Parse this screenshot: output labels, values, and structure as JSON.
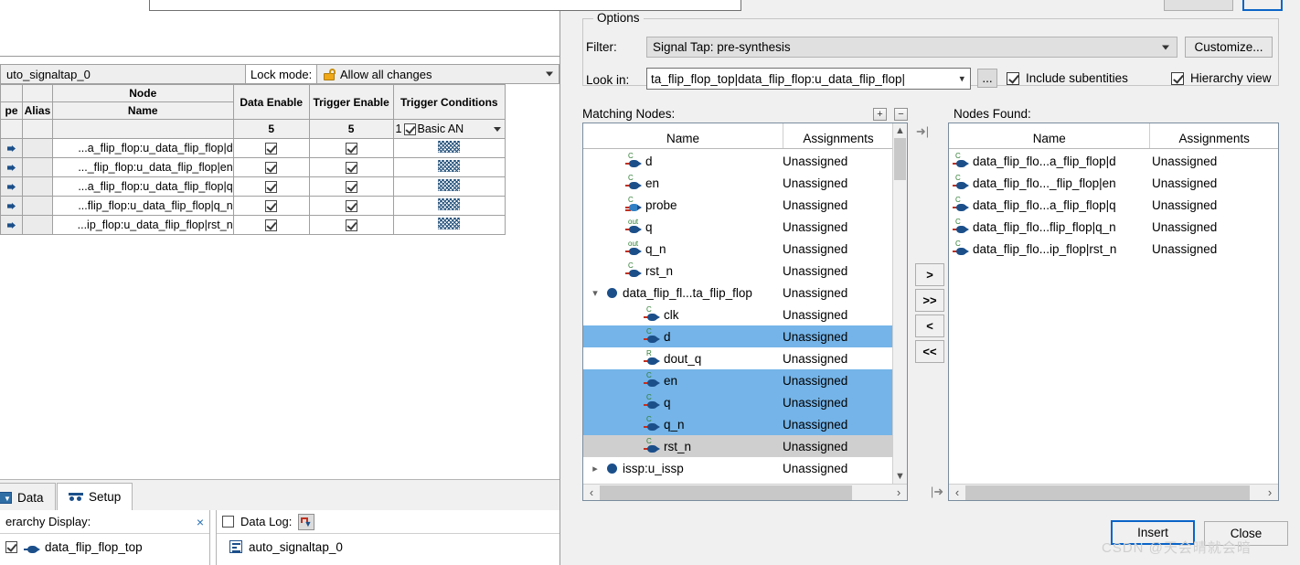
{
  "background_app": {
    "instance_name": "uto_signaltap_0",
    "lock_mode_label": "Lock mode:",
    "lock_mode_value": "Allow all changes",
    "lock_icon": "unlocked-padlock-icon",
    "table": {
      "group_header": "Node",
      "columns": [
        "pe",
        "Alias",
        "Name",
        "Data Enable",
        "Trigger Enable",
        "Trigger Conditions"
      ],
      "counts": [
        "",
        "",
        "",
        "5",
        "5",
        "1"
      ],
      "trigger_condition_mode": "Basic AN",
      "rows": [
        {
          "type_icon": "signal-arrow-icon",
          "alias": "",
          "name": "...a_flip_flop:u_data_flip_flop|d",
          "data_enable": true,
          "trigger_enable": true,
          "trigger_condition": "hatched-pattern"
        },
        {
          "type_icon": "signal-arrow-icon",
          "alias": "",
          "name": "..._flip_flop:u_data_flip_flop|en",
          "data_enable": true,
          "trigger_enable": true,
          "trigger_condition": "hatched-pattern"
        },
        {
          "type_icon": "signal-arrow-icon",
          "alias": "",
          "name": "...a_flip_flop:u_data_flip_flop|q",
          "data_enable": true,
          "trigger_enable": true,
          "trigger_condition": "hatched-pattern"
        },
        {
          "type_icon": "signal-arrow-icon",
          "alias": "",
          "name": "...flip_flop:u_data_flip_flop|q_n",
          "data_enable": true,
          "trigger_enable": true,
          "trigger_condition": "hatched-pattern"
        },
        {
          "type_icon": "signal-arrow-icon",
          "alias": "",
          "name": "...ip_flop:u_data_flip_flop|rst_n",
          "data_enable": true,
          "trigger_enable": true,
          "trigger_condition": "hatched-pattern"
        }
      ]
    },
    "tabs": [
      {
        "label": "Data",
        "icon": "data-tab-icon",
        "active": false
      },
      {
        "label": "Setup",
        "icon": "setup-tab-icon",
        "active": true
      }
    ],
    "hierarchy_pane": {
      "title": "erarchy Display:",
      "close_glyph": "×",
      "item_label": "data_flip_flop_top",
      "item_checked": true,
      "item_icon": "signal-arrow-icon"
    },
    "datalog_pane": {
      "title": "Data Log:",
      "checked": false,
      "badge_icon": "waveform-save-icon",
      "item_label": "auto_signaltap_0",
      "item_icon": "signaltap-file-icon"
    }
  },
  "dialog": {
    "options_group_title": "Options",
    "filter_label": "Filter:",
    "filter_value": "Signal Tap: pre-synthesis",
    "customize_button": "Customize...",
    "look_in_label": "Look in:",
    "look_in_value": "ta_flip_flop_top|data_flip_flop:u_data_flip_flop|",
    "browse_button": "...",
    "include_subentities": {
      "label": "Include subentities",
      "checked": true
    },
    "hierarchy_view": {
      "label": "Hierarchy view",
      "checked": true
    },
    "matching_nodes_label": "Matching Nodes:",
    "nodes_found_label": "Nodes Found:",
    "expand_all_icon": "expand-all-icon",
    "collapse_all_icon": "collapse-all-icon",
    "column_headers": {
      "name": "Name",
      "assignments": "Assignments"
    },
    "matching_nodes": [
      {
        "name": "d",
        "assignment": "Unassigned",
        "icon": "input-pin-icon",
        "tag": "C",
        "indent": 1,
        "twisty": "",
        "state": ""
      },
      {
        "name": "en",
        "assignment": "Unassigned",
        "icon": "input-pin-icon",
        "tag": "C",
        "indent": 1,
        "twisty": "",
        "state": ""
      },
      {
        "name": "probe",
        "assignment": "Unassigned",
        "icon": "bus-pin-icon",
        "tag": "C",
        "indent": 1,
        "twisty": "",
        "state": ""
      },
      {
        "name": "q",
        "assignment": "Unassigned",
        "icon": "output-pin-icon",
        "tag": "out",
        "indent": 1,
        "twisty": "",
        "state": ""
      },
      {
        "name": "q_n",
        "assignment": "Unassigned",
        "icon": "output-pin-icon",
        "tag": "out",
        "indent": 1,
        "twisty": "",
        "state": ""
      },
      {
        "name": "rst_n",
        "assignment": "Unassigned",
        "icon": "input-pin-icon",
        "tag": "C",
        "indent": 1,
        "twisty": "",
        "state": ""
      },
      {
        "name": "data_flip_fl...ta_flip_flop",
        "assignment": "Unassigned",
        "icon": "instance-icon",
        "tag": "",
        "indent": 0,
        "twisty": "expanded",
        "state": ""
      },
      {
        "name": "clk",
        "assignment": "Unassigned",
        "icon": "input-pin-icon",
        "tag": "C",
        "indent": 2,
        "twisty": "",
        "state": ""
      },
      {
        "name": "d",
        "assignment": "Unassigned",
        "icon": "input-pin-icon",
        "tag": "C",
        "indent": 2,
        "twisty": "",
        "state": "selected"
      },
      {
        "name": "dout_q",
        "assignment": "Unassigned",
        "icon": "reg-pin-icon",
        "tag": "R",
        "indent": 2,
        "twisty": "",
        "state": ""
      },
      {
        "name": "en",
        "assignment": "Unassigned",
        "icon": "input-pin-icon",
        "tag": "C",
        "indent": 2,
        "twisty": "",
        "state": "selected"
      },
      {
        "name": "q",
        "assignment": "Unassigned",
        "icon": "input-pin-icon",
        "tag": "C",
        "indent": 2,
        "twisty": "",
        "state": "selected"
      },
      {
        "name": "q_n",
        "assignment": "Unassigned",
        "icon": "input-pin-icon",
        "tag": "C",
        "indent": 2,
        "twisty": "",
        "state": "selected"
      },
      {
        "name": "rst_n",
        "assignment": "Unassigned",
        "icon": "input-pin-icon",
        "tag": "C",
        "indent": 2,
        "twisty": "",
        "state": "focused"
      },
      {
        "name": "issp:u_issp",
        "assignment": "Unassigned",
        "icon": "instance-icon",
        "tag": "",
        "indent": 0,
        "twisty": "collapsed",
        "state": ""
      }
    ],
    "nodes_found": [
      {
        "name": "data_flip_flo...a_flip_flop|d",
        "assignment": "Unassigned",
        "icon": "input-pin-icon",
        "tag": "C"
      },
      {
        "name": "data_flip_flo..._flip_flop|en",
        "assignment": "Unassigned",
        "icon": "input-pin-icon",
        "tag": "C"
      },
      {
        "name": "data_flip_flo...a_flip_flop|q",
        "assignment": "Unassigned",
        "icon": "input-pin-icon",
        "tag": "C"
      },
      {
        "name": "data_flip_flo...flip_flop|q_n",
        "assignment": "Unassigned",
        "icon": "input-pin-icon",
        "tag": "C"
      },
      {
        "name": "data_flip_flo...ip_flop|rst_n",
        "assignment": "Unassigned",
        "icon": "input-pin-icon",
        "tag": "C"
      }
    ],
    "move_buttons": [
      {
        "label": ">",
        "name": "move-right-button"
      },
      {
        "label": ">>",
        "name": "move-all-right-button"
      },
      {
        "label": "<",
        "name": "move-left-button"
      },
      {
        "label": "<<",
        "name": "move-all-left-button"
      }
    ],
    "insert_button": "Insert",
    "close_button": "Close"
  },
  "watermark": "CSDN @天会晴就会暗",
  "colors": {
    "selection_blue": "#74b4e8",
    "focus_gray": "#cfcfcf",
    "dialog_bg": "#f0f0f0",
    "accent_blue": "#0a64c8",
    "pin_blue": "#1b4f8a",
    "tag_green": "#2e7d32"
  }
}
